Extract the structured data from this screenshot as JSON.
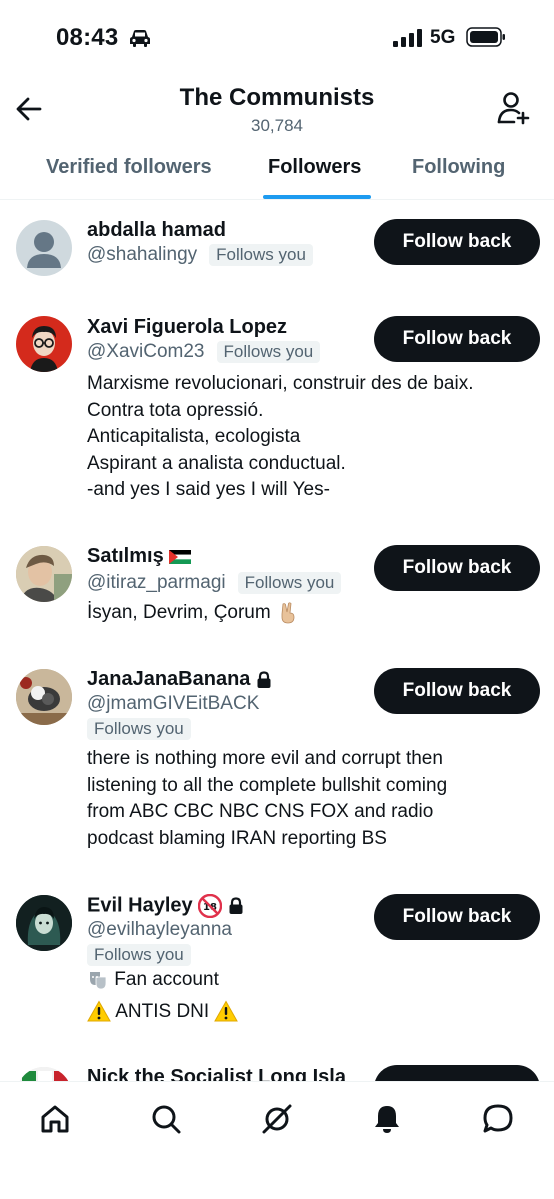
{
  "status_bar": {
    "time": "08:43",
    "network": "5G",
    "icons": [
      "car-icon",
      "signal-icon",
      "battery-icon"
    ]
  },
  "header": {
    "title": "The Communists",
    "count": "30,784",
    "icons": [
      "back-arrow-icon",
      "add-user-icon"
    ]
  },
  "tabs": [
    {
      "label": "Verified followers",
      "active": false
    },
    {
      "label": "Followers",
      "active": true
    },
    {
      "label": "Following",
      "active": false
    }
  ],
  "accent_color": "#1d9bf0",
  "followers": [
    {
      "name": "abdalla hamad",
      "handle": "@shahalingy",
      "badge": "Follows you",
      "button": "Follow back",
      "bio": []
    },
    {
      "name": "Xavi Figuerola Lopez",
      "handle": "@XaviCom23",
      "badge": "Follows you",
      "button": "Follow back",
      "bio": [
        "Marxisme revolucionari, construir des de baix.",
        "Contra tota opressió.",
        "Anticapitalista, ecologista",
        "Aspirant a analista conductual.",
        "-and yes I said yes I will Yes-"
      ]
    },
    {
      "name": "Satılmış",
      "name_icon": "palestine-flag-icon",
      "handle": "@itiraz_parmagi",
      "badge": "Follows you",
      "button": "Follow back",
      "bio": [
        "İsyan, Devrim, Çorum"
      ],
      "bio_icon": "victory-hand-icon"
    },
    {
      "name": "JanaJanaBanana",
      "name_icon": "lock-icon",
      "handle": "@jmamGIVEitBACK",
      "badge": "Follows you",
      "button": "Follow back",
      "bio": [
        "there is nothing more evil and corrupt then",
        "listening to all the complete bullshit coming",
        "from ABC CBC NBC CNS FOX and radio",
        "podcast blaming IRAN reporting BS"
      ]
    },
    {
      "name": "Evil Hayley",
      "name_icons": [
        "no-under-18-icon",
        "lock-icon"
      ],
      "handle": "@evilhayleyanna",
      "badge": "Follows you",
      "button": "Follow back",
      "bio": [
        "Fan account",
        "ANTIS DNI"
      ],
      "bio_icons": [
        "theater-masks-icon",
        "warning-icon"
      ]
    },
    {
      "name": "Nick the Socialist Long Isla"
    }
  ],
  "bottom_nav": [
    "home-icon",
    "search-icon",
    "grok-icon",
    "notifications-icon",
    "messages-icon"
  ]
}
